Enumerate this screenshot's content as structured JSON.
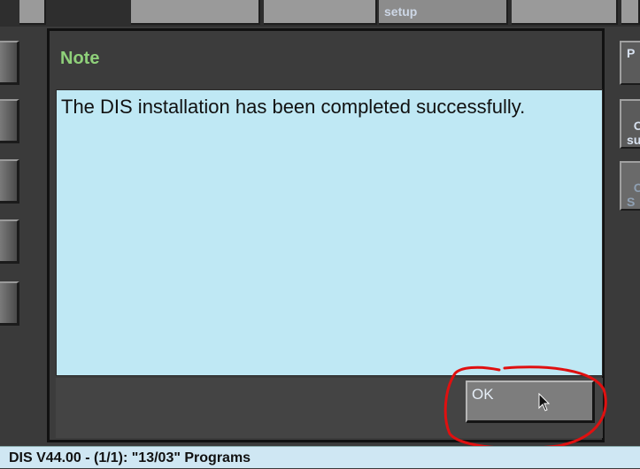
{
  "top_toolbar": {
    "setup_label": "setup"
  },
  "right_panel": {
    "btn1_label": "P",
    "btn2_label": "O\nsu",
    "btn3_label": "O\nS"
  },
  "dialog": {
    "title": "Note",
    "message": "The DIS installation has been completed successfully.",
    "ok_label": "OK"
  },
  "status_bar": {
    "text": "DIS V44.00  - (1/1): \"13/03\" Programs"
  },
  "colors": {
    "title_green": "#8fd07a",
    "body_blue": "#bfe8f4",
    "highlight_red": "#e01010"
  },
  "icons": {
    "cursor": "mouse-pointer-icon"
  }
}
